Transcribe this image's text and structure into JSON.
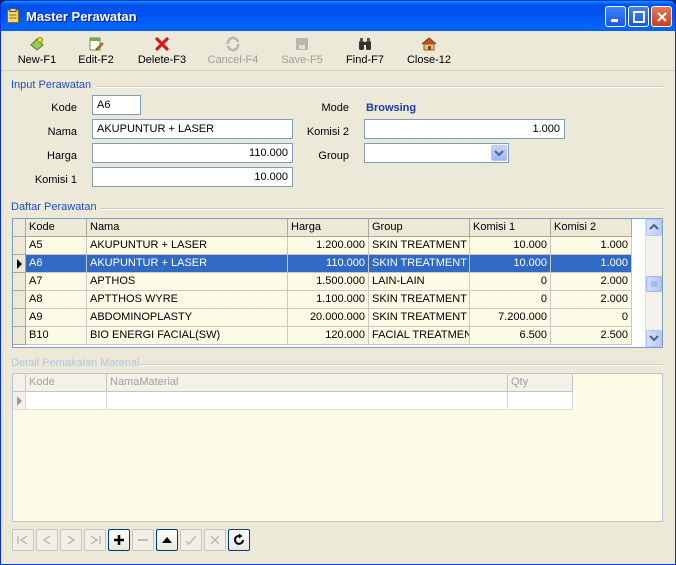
{
  "window": {
    "title": "Master Perawatan"
  },
  "toolbar": {
    "new": "New-F1",
    "edit": "Edit-F2",
    "delete": "Delete-F3",
    "cancel": "Cancel-F4",
    "save": "Save-F5",
    "find": "Find-F7",
    "close": "Close-12"
  },
  "input_section": {
    "title": "Input Perawatan",
    "kode_label": "Kode",
    "kode_value": "A6",
    "nama_label": "Nama",
    "nama_value": "AKUPUNTUR + LASER",
    "harga_label": "Harga",
    "harga_value": "110.000",
    "komisi1_label": "Komisi 1",
    "komisi1_value": "10.000",
    "mode_label": "Mode",
    "mode_value": "Browsing",
    "komisi2_label": "Komisi 2",
    "komisi2_value": "1.000",
    "group_label": "Group",
    "group_value": ""
  },
  "daftar": {
    "title": "Daftar Perawatan",
    "columns": [
      "Kode",
      "Nama",
      "Harga",
      "Group",
      "Komisi 1",
      "Komisi 2"
    ],
    "rows": [
      [
        "A5",
        "AKUPUNTUR + LASER",
        "1.200.000",
        "SKIN TREATMENT",
        "10.000",
        "1.000"
      ],
      [
        "A6",
        "AKUPUNTUR + LASER",
        "110.000",
        "SKIN TREATMENT",
        "10.000",
        "1.000"
      ],
      [
        "A7",
        "APTHOS",
        "1.500.000",
        "LAIN-LAIN",
        "0",
        "2.000"
      ],
      [
        "A8",
        "APTTHOS WYRE",
        "1.100.000",
        "SKIN TREATMENT",
        "0",
        "2.000"
      ],
      [
        "A9",
        "ABDOMINOPLASTY",
        "20.000.000",
        "SKIN TREATMENT",
        "7.200.000",
        "0"
      ],
      [
        "B10",
        "BIO ENERGI  FACIAL(SW)",
        "120.000",
        "FACIAL TREATMENT",
        "6.500",
        "2.500"
      ]
    ],
    "selected_row": 1
  },
  "detail": {
    "title": "Detail Pemakaian Material",
    "columns": [
      "Kode",
      "NamaMaterial",
      "Qty"
    ]
  },
  "colors": {
    "selection": "#316ac5",
    "group_title": "#1f4fbf",
    "mode_value": "#1c3ea6",
    "row_bg": "#fbfbe6"
  }
}
